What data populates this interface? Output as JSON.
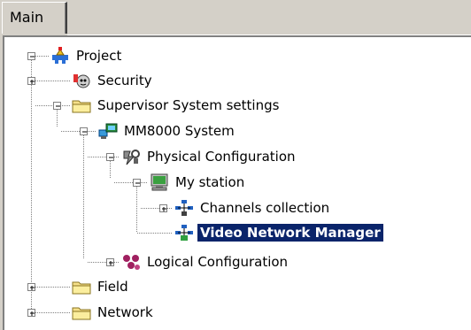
{
  "tabs": [
    {
      "label": "Main"
    }
  ],
  "tree": [
    {
      "id": "project",
      "label": "Project",
      "icon": "project-icon",
      "expanded": true
    },
    {
      "id": "security",
      "label": "Security",
      "icon": "security-icon",
      "expanded": false
    },
    {
      "id": "supervisor",
      "label": "Supervisor System settings",
      "icon": "folder-icon",
      "expanded": true
    },
    {
      "id": "mm8000",
      "label": "MM8000 System",
      "icon": "system-computer-icon",
      "expanded": true
    },
    {
      "id": "physical",
      "label": "Physical Configuration",
      "icon": "physical-config-icon",
      "expanded": true
    },
    {
      "id": "mystation",
      "label": "My station",
      "icon": "monitor-icon",
      "expanded": true
    },
    {
      "id": "channels",
      "label": "Channels collection",
      "icon": "channels-network-icon",
      "expanded": false
    },
    {
      "id": "vnm",
      "label": "Video Network Manager",
      "icon": "video-network-icon",
      "selected": true
    },
    {
      "id": "logical",
      "label": "Logical Configuration",
      "icon": "logical-config-icon",
      "expanded": false
    },
    {
      "id": "field",
      "label": "Field",
      "icon": "folder-icon",
      "expanded": false
    },
    {
      "id": "network",
      "label": "Network",
      "icon": "folder-icon",
      "expanded": false
    }
  ]
}
